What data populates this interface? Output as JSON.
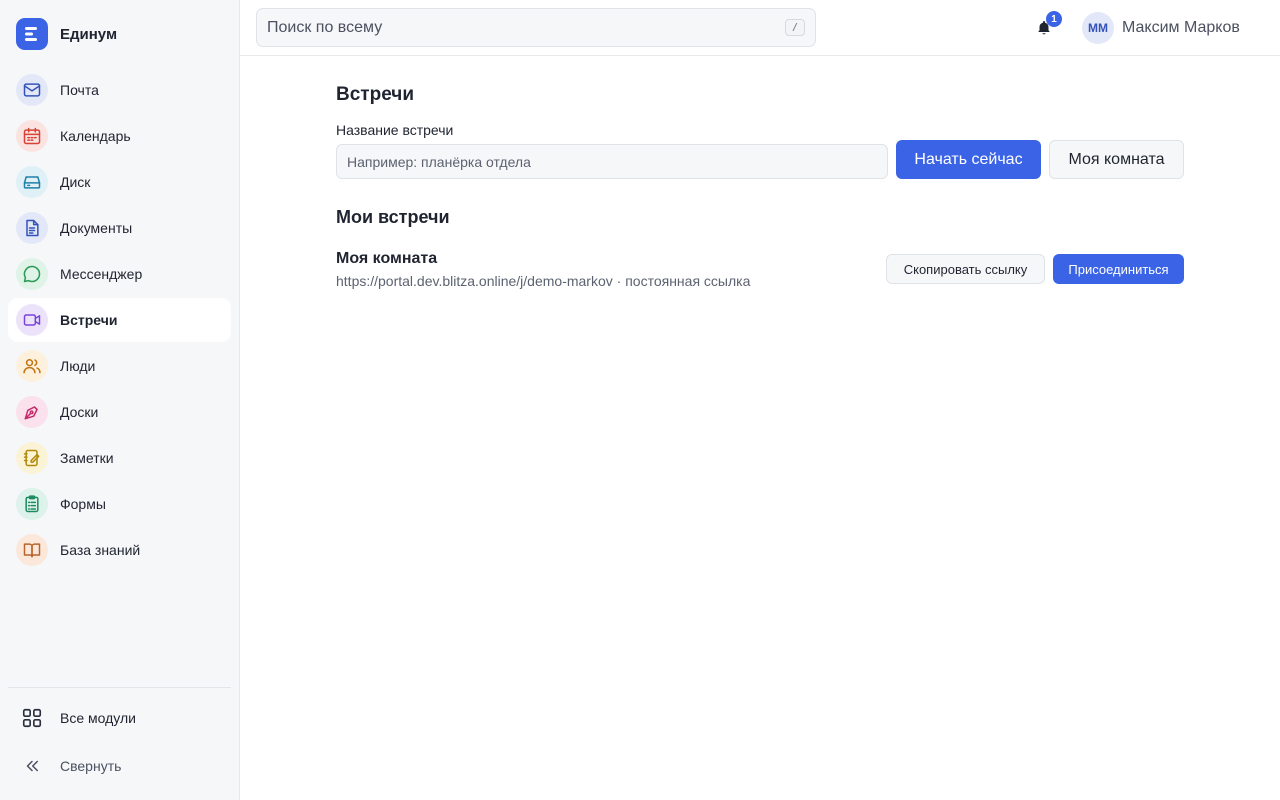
{
  "brand": {
    "name": "Единум",
    "accent": "#3b63e6"
  },
  "sidebar": {
    "items": [
      {
        "label": "Почта",
        "icon": "mail-icon",
        "bg": "#e3e8f8",
        "color": "#3453b8"
      },
      {
        "label": "Календарь",
        "icon": "calendar-icon",
        "bg": "#fbe3e1",
        "color": "#d64236"
      },
      {
        "label": "Диск",
        "icon": "drive-icon",
        "bg": "#dff1f6",
        "color": "#1f7fa8"
      },
      {
        "label": "Документы",
        "icon": "document-icon",
        "bg": "#e3e8f8",
        "color": "#3453b8"
      },
      {
        "label": "Мессенджер",
        "icon": "chat-icon",
        "bg": "#dff3e7",
        "color": "#2a9a58"
      },
      {
        "label": "Встречи",
        "icon": "video-icon",
        "bg": "#ece3fa",
        "color": "#7a44d8",
        "active": true
      },
      {
        "label": "Люди",
        "icon": "people-icon",
        "bg": "#fdf0dc",
        "color": "#c27410"
      },
      {
        "label": "Доски",
        "icon": "pen-icon",
        "bg": "#fbe1ec",
        "color": "#c42b6b"
      },
      {
        "label": "Заметки",
        "icon": "notes-icon",
        "bg": "#fbf3d6",
        "color": "#b08a0a"
      },
      {
        "label": "Формы",
        "icon": "clipboard-icon",
        "bg": "#dcf2ea",
        "color": "#1d8a62"
      },
      {
        "label": "База знаний",
        "icon": "book-icon",
        "bg": "#fbe8da",
        "color": "#b8642a"
      }
    ],
    "all_modules": "Все модули",
    "collapse": "Свернуть"
  },
  "header": {
    "search_placeholder": "Поиск по всему",
    "search_shortcut": "/",
    "notifications_count": "1",
    "user_initials": "ММ",
    "user_name": "Максим Марков"
  },
  "main": {
    "title": "Встречи",
    "name_label": "Название встречи",
    "name_placeholder": "Например: планёрка отдела",
    "start_now": "Начать сейчас",
    "my_room": "Моя комната",
    "my_meetings_title": "Мои встречи",
    "room": {
      "name": "Моя комната",
      "link": "https://portal.dev.blitza.online/j/demo-markov · постоянная ссылка",
      "copy_link": "Скопировать ссылку",
      "join": "Присоединиться"
    }
  }
}
